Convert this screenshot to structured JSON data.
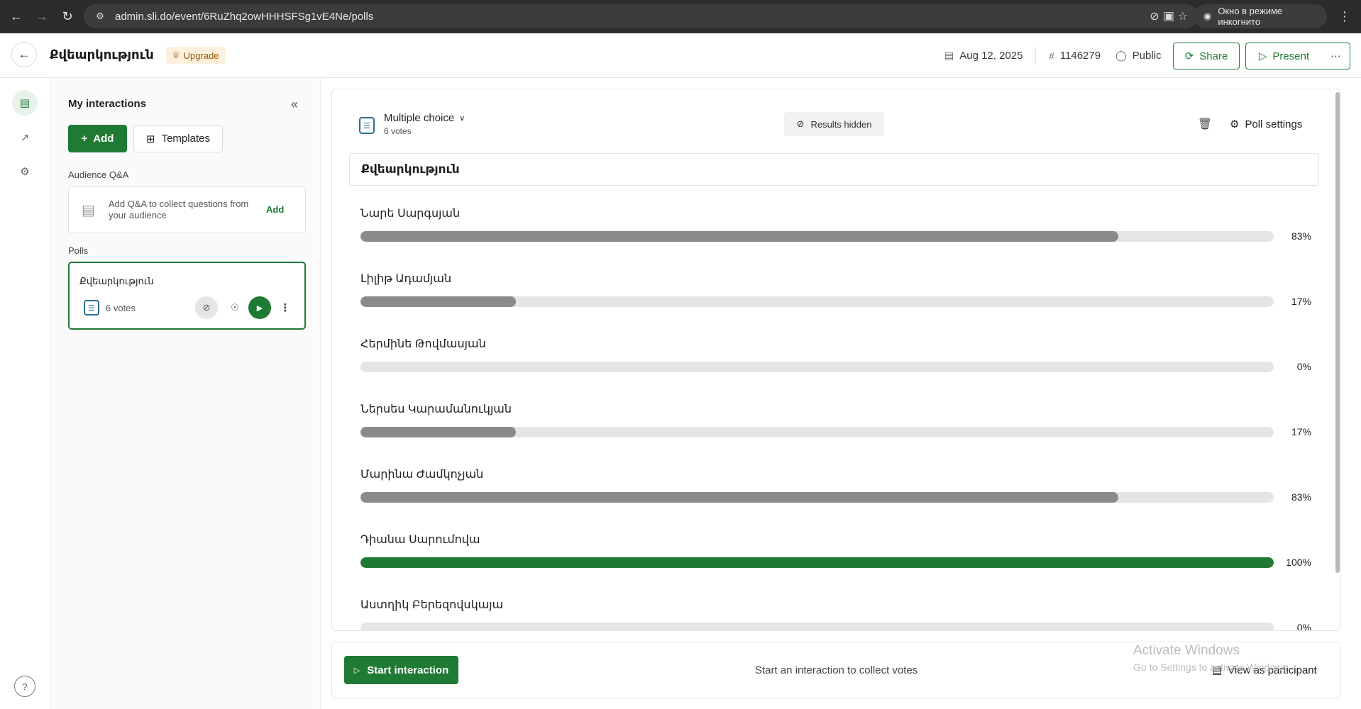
{
  "browser": {
    "url": "admin.sli.do/event/6RuZhq2owHHHSFSg1vE4Ne/polls",
    "incognito_label": "Окно в режиме инкогнито"
  },
  "header": {
    "event_title": "Քվեարկություն",
    "upgrade_label": "Upgrade",
    "date": "Aug 12, 2025",
    "event_code": "1146279",
    "visibility": "Public",
    "share_label": "Share",
    "present_label": "Present"
  },
  "sidebar": {
    "title": "My interactions",
    "add_label": "Add",
    "templates_label": "Templates",
    "qa_section": "Audience Q&A",
    "qa_text": "Add Q&A to collect questions from your audience",
    "qa_add": "Add",
    "polls_section": "Polls",
    "poll": {
      "title": "Քվեարկություն",
      "votes": "6 votes"
    }
  },
  "poll": {
    "type_label": "Multiple choice",
    "votes": "6 votes",
    "results_hidden_label": "Results hidden",
    "settings_label": "Poll settings",
    "question": "Քվեարկություն",
    "options": [
      {
        "label": "Նարե Սարգսյան",
        "percent_label": "83%",
        "value": 83,
        "winner": false
      },
      {
        "label": "Լիլիթ Ադամյան",
        "percent_label": "17%",
        "value": 17,
        "winner": false
      },
      {
        "label": "Հերմինե Թովմասյան",
        "percent_label": "0%",
        "value": 0,
        "winner": false
      },
      {
        "label": "Ներսես Կարամանուկյան",
        "percent_label": "17%",
        "value": 17,
        "winner": false
      },
      {
        "label": "Մարինա Ժամկոչյան",
        "percent_label": "83%",
        "value": 83,
        "winner": false
      },
      {
        "label": "Դիանա Սարումովա",
        "percent_label": "100%",
        "value": 100,
        "winner": true
      },
      {
        "label": "Աստղիկ Բերեզովսկայա",
        "percent_label": "0%",
        "value": 0,
        "winner": false
      }
    ]
  },
  "footer": {
    "start_label": "Start interaction",
    "message": "Start an interaction to collect votes",
    "participant_label": "View as participant"
  },
  "watermark": {
    "title": "Activate Windows",
    "subtitle": "Go to Settings to activate Windows."
  },
  "colors": {
    "brand_green": "#1f7a34",
    "bar_gray": "#8a8a8a",
    "track": "#e5e5e5",
    "poll_type_blue": "#2a6f93"
  }
}
